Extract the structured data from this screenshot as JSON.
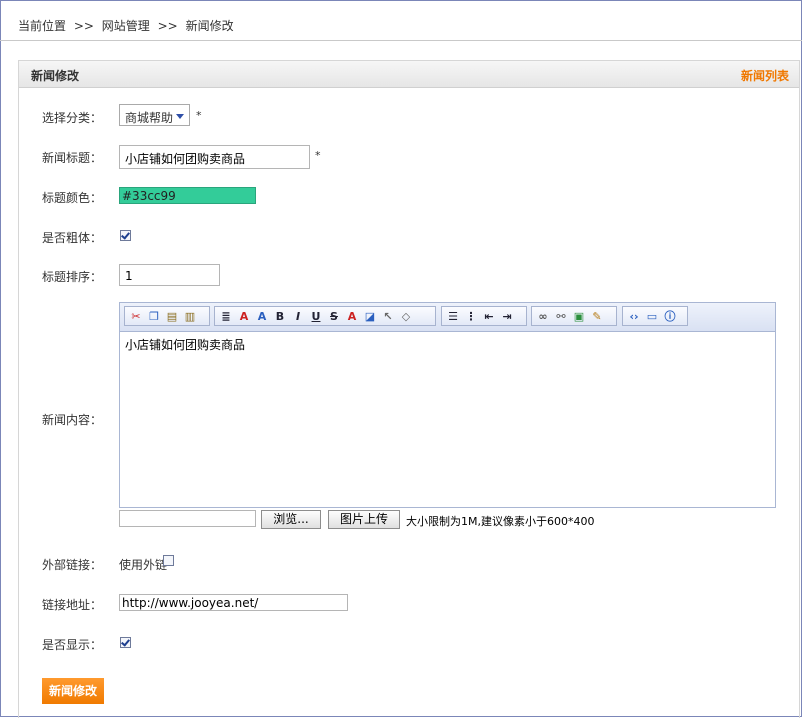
{
  "breadcrumb": {
    "current": "当前位置",
    "sep1": ">>",
    "site": "网站管理",
    "sep2": ">>",
    "page": "新闻修改"
  },
  "panel": {
    "title": "新闻修改",
    "list_link": "新闻列表"
  },
  "form": {
    "category_label": "选择分类：",
    "category_value": "商城帮助",
    "required_mark": "*",
    "title_label": "新闻标题：",
    "title_value": "小店铺如何团购卖商品",
    "color_label": "标题颜色：",
    "color_value": "#33cc99",
    "bold_label": "是否粗体：",
    "bold_checked": true,
    "order_label": "标题排序：",
    "order_value": "1",
    "content_label": "新闻内容：",
    "content_text": "小店铺如何团购卖商品",
    "browse_button": "浏览...",
    "upload_button": "图片上传",
    "upload_hint": "大小限制为1M,建议像素小于600*400",
    "external_label": "外部链接：",
    "external_checkbox_label": "使用外链",
    "external_checked": false,
    "url_label": "链接地址：",
    "url_value": "http://www.jooyea.net/",
    "display_label": "是否显示：",
    "display_checked": true,
    "submit_button": "新闻修改"
  },
  "colors": {
    "accent": "#f07800",
    "title_color": "#33cc99"
  },
  "toolbar": {
    "icons": [
      "cut-icon",
      "copy-icon",
      "paste-icon",
      "paste-word-icon",
      "format-icon",
      "font-icon",
      "font-size-icon",
      "bold-icon",
      "italic-icon",
      "underline-icon",
      "strikethrough-icon",
      "text-color-icon",
      "highlight-icon",
      "select-icon",
      "eraser-icon",
      "align-icon",
      "list-icon",
      "outdent-icon",
      "indent-icon",
      "link-icon",
      "unlink-icon",
      "image-icon",
      "edit-icon",
      "source-icon",
      "preview-icon",
      "about-icon"
    ]
  }
}
